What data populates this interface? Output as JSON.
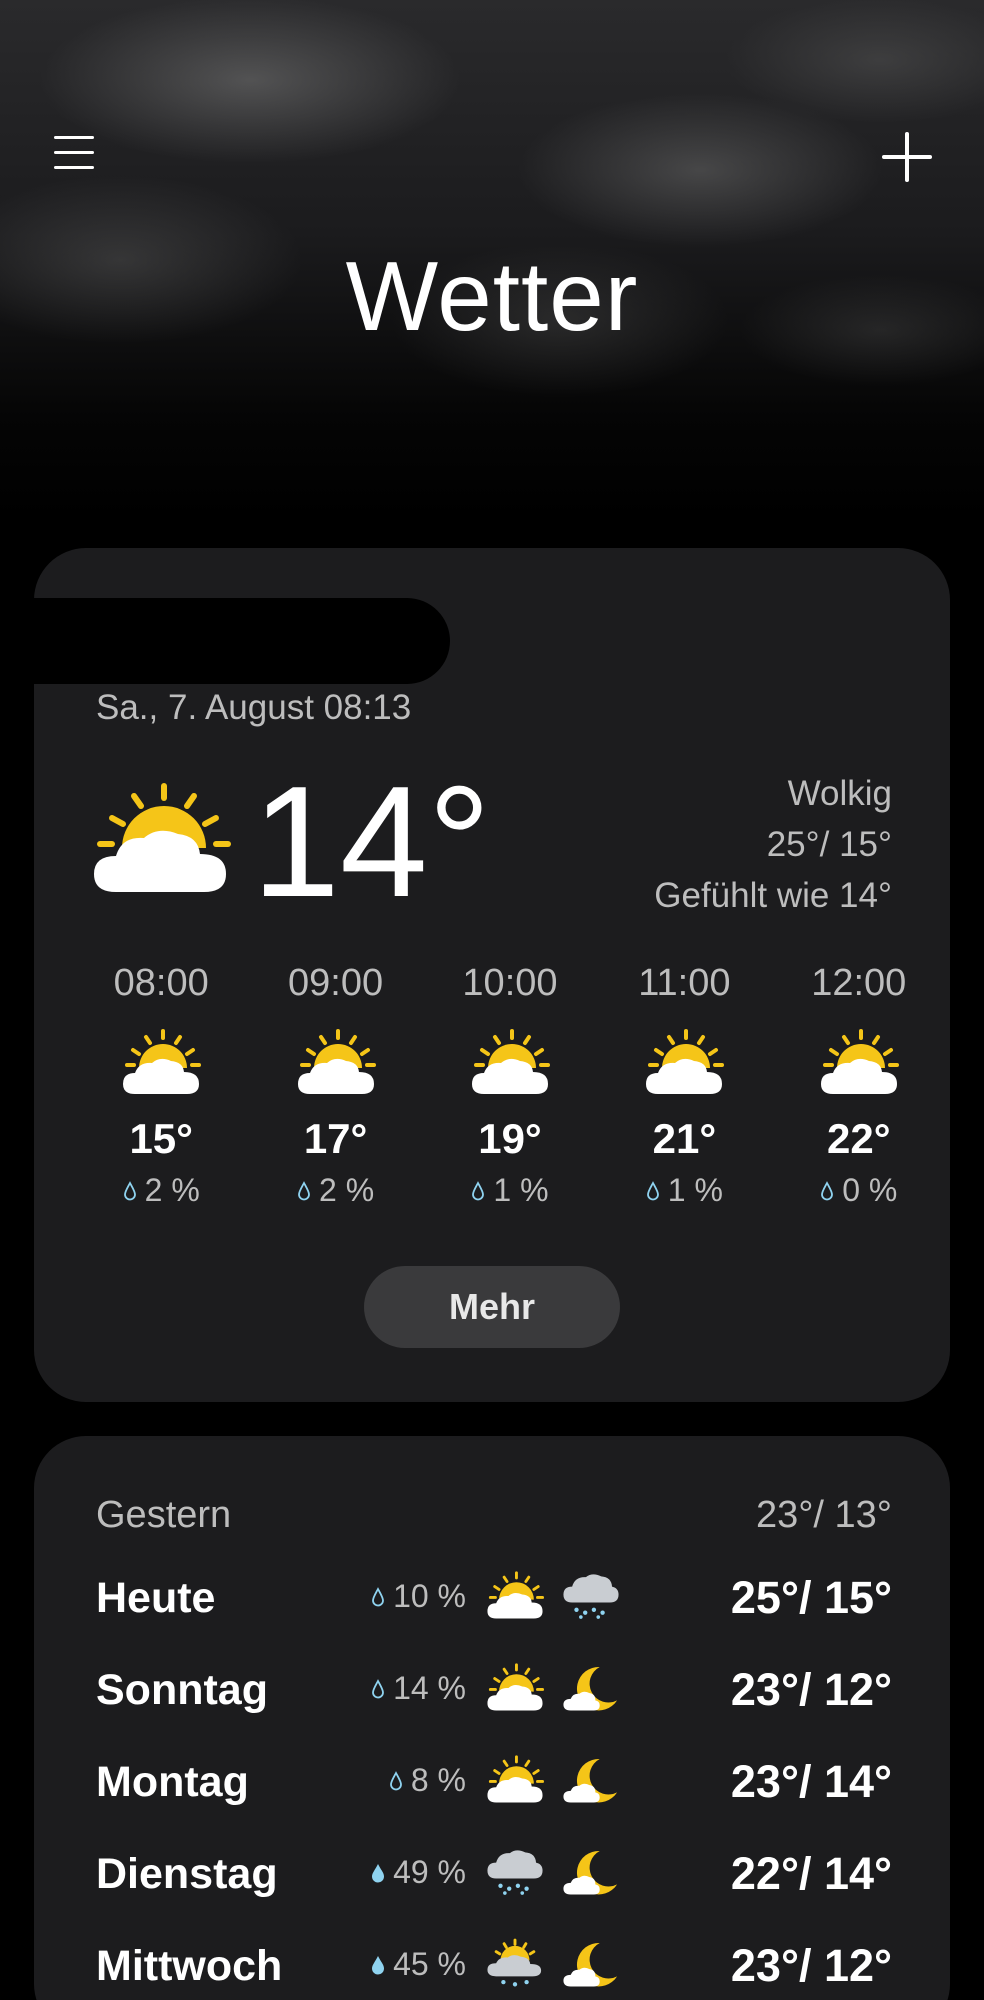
{
  "header": {
    "title": "Wetter",
    "menu_icon": "hamburger-menu-icon",
    "add_icon": "plus-icon"
  },
  "current": {
    "datetime": "Sa., 7. August 08:13",
    "temperature": "14°",
    "condition": "Wolkig",
    "high_low": "25°/ 15°",
    "feels_like": "Gefühlt wie 14°",
    "icon": "partly-sunny-icon",
    "more_label": "Mehr"
  },
  "hourly": [
    {
      "time": "08:00",
      "temp": "15°",
      "precip": "2 %",
      "icon": "partly-sunny-icon"
    },
    {
      "time": "09:00",
      "temp": "17°",
      "precip": "2 %",
      "icon": "partly-sunny-icon"
    },
    {
      "time": "10:00",
      "temp": "19°",
      "precip": "1 %",
      "icon": "partly-sunny-icon"
    },
    {
      "time": "11:00",
      "temp": "21°",
      "precip": "1 %",
      "icon": "partly-sunny-icon"
    },
    {
      "time": "12:00",
      "temp": "22°",
      "precip": "0 %",
      "icon": "partly-sunny-icon"
    }
  ],
  "forecast": {
    "yesterday_label": "Gestern",
    "yesterday_range": "23°/ 13°",
    "days": [
      {
        "name": "Heute",
        "precip": "10 %",
        "day_icon": "partly-sunny-icon",
        "night_icon": "rain-cloud-icon",
        "range": "25°/ 15°"
      },
      {
        "name": "Sonntag",
        "precip": "14 %",
        "day_icon": "partly-sunny-icon",
        "night_icon": "moon-cloud-icon",
        "range": "23°/ 12°"
      },
      {
        "name": "Montag",
        "precip": "8 %",
        "day_icon": "partly-sunny-icon",
        "night_icon": "moon-cloud-icon",
        "range": "23°/ 14°"
      },
      {
        "name": "Dienstag",
        "precip": "49 %",
        "day_icon": "rain-cloud-icon",
        "night_icon": "moon-cloud-icon",
        "range": "22°/ 14°"
      },
      {
        "name": "Mittwoch",
        "precip": "45 %",
        "day_icon": "sun-rain-cloud-icon",
        "night_icon": "moon-cloud-icon",
        "range": "23°/ 12°"
      }
    ]
  },
  "colors": {
    "sun": "#f5c518",
    "cloud": "#ffffff",
    "rain_cloud": "#c9cdd2",
    "rain_drop": "#8fd3f0",
    "card": "#1c1c1e"
  }
}
